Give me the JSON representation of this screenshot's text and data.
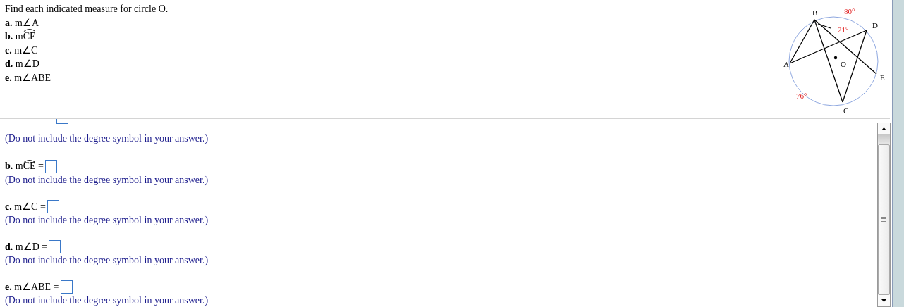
{
  "question": {
    "prompt": "Find each indicated measure for circle O.",
    "parts": [
      {
        "letter": "a.",
        "kind": "angle",
        "measure": "m∠A"
      },
      {
        "letter": "b.",
        "kind": "arc",
        "prefix": "m",
        "arc": "CE"
      },
      {
        "letter": "c.",
        "kind": "angle",
        "measure": "m∠C"
      },
      {
        "letter": "d.",
        "kind": "angle",
        "measure": "m∠D"
      },
      {
        "letter": "e.",
        "kind": "angle",
        "measure": "m∠ABE"
      }
    ]
  },
  "diagram": {
    "points": [
      "A",
      "B",
      "C",
      "D",
      "E",
      "O"
    ],
    "measures": [
      "80°",
      "21°",
      "76°"
    ]
  },
  "answers": [
    {
      "kind": "cut_off",
      "hint": "(Do not include the degree symbol in your answer.)"
    },
    {
      "kind": "arc",
      "letter": "b.",
      "prefix": "m",
      "arc": "CE",
      "equals": "=",
      "hint": "(Do not include the degree symbol in your answer.)"
    },
    {
      "kind": "angle",
      "letter": "c.",
      "measure": "m∠C",
      "equals": "=",
      "hint": "(Do not include the degree symbol in your answer.)"
    },
    {
      "kind": "angle",
      "letter": "d.",
      "measure": "m∠D",
      "equals": "=",
      "hint": "(Do not include the degree symbol in your answer.)"
    },
    {
      "kind": "angle",
      "letter": "e.",
      "measure": "m∠ABE",
      "equals": "=",
      "hint": "(Do not include the degree symbol in your answer.)"
    }
  ]
}
